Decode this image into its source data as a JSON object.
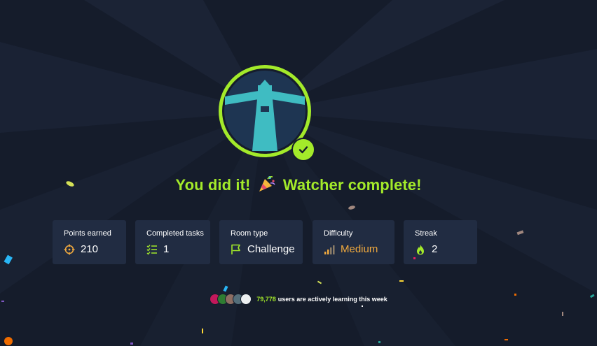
{
  "headline": {
    "prefix": "You did it!",
    "emoji": "🎉",
    "suffix": "Watcher complete!"
  },
  "room_badge": {
    "icon": "lighthouse-icon",
    "status": "completed"
  },
  "stats": {
    "points": {
      "label": "Points earned",
      "value": "210",
      "icon": "crosshair-icon"
    },
    "tasks": {
      "label": "Completed tasks",
      "value": "1",
      "icon": "checklist-icon"
    },
    "room_type": {
      "label": "Room type",
      "value": "Challenge",
      "icon": "flag-icon"
    },
    "difficulty": {
      "label": "Difficulty",
      "value": "Medium",
      "icon": "signal-bars-icon"
    },
    "streak": {
      "label": "Streak",
      "value": "2",
      "icon": "flame-icon"
    }
  },
  "community": {
    "count": "79,778",
    "text": "users are actively learning this week"
  },
  "colors": {
    "background": "#151c2b",
    "card": "#212c42",
    "accent": "#a3ea2a",
    "badge_teal": "#3fbcc2",
    "medium": "#f0a93e"
  }
}
